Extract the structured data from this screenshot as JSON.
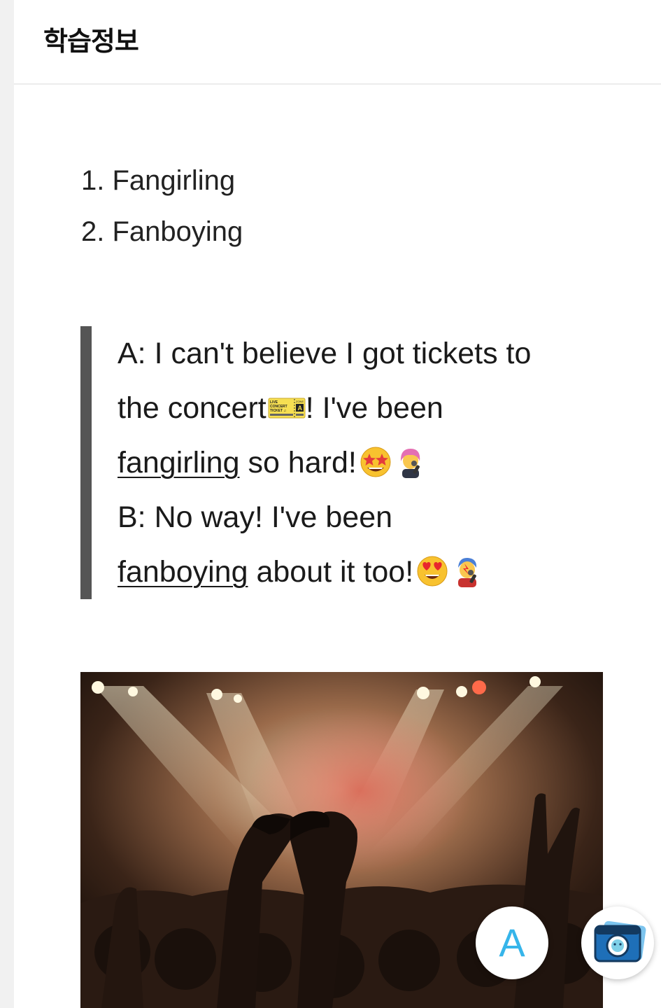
{
  "header": {
    "title": "학습정보"
  },
  "terms": [
    "1. Fangirling",
    "2. Fanboying"
  ],
  "dialogue": {
    "line1": "A: I can't believe I got tickets to",
    "line2_text": "the concert",
    "line2_after": "! I've been",
    "line3_keyword": "fangirling",
    "line3_after": " so hard!",
    "line4": "B: No way! I've been",
    "line5_keyword": "fanboying",
    "line5_after": " about it too!"
  },
  "ticket": {
    "line_a": "LIVE",
    "line_b": "CONCERT",
    "line_c": "TICKET ♫",
    "zone_label": "ZONE",
    "zone": "A"
  },
  "icons": [
    "ticket-emoji",
    "star-struck-emoji",
    "woman-singer-emoji",
    "heart-eyes-emoji",
    "man-singer-emoji",
    "camera-icon"
  ],
  "fab": {
    "translate_label": "A"
  },
  "colors": {
    "accent": "#36b5ea",
    "quote_bar": "#555555"
  }
}
